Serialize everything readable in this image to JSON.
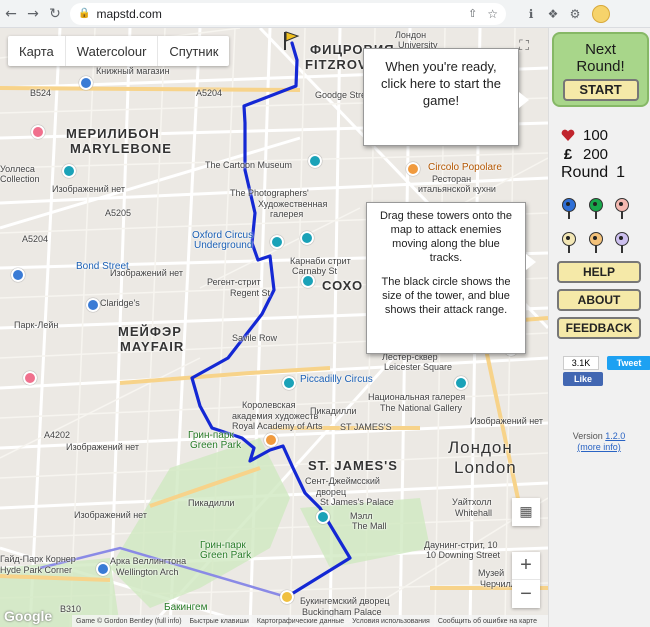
{
  "browser": {
    "back": "←",
    "forward": "→",
    "reload": "↻",
    "url": "mapstd.com",
    "lock": "🔒"
  },
  "map": {
    "map_types": [
      "Карта",
      "Watercolour",
      "Спутник"
    ],
    "google": "Google",
    "footer": [
      "Game © Gordon Bentley (full info)",
      "Быстрые клавиши",
      "Картографические данные",
      "Условия использования",
      "Сообщить об ошибке на карте"
    ],
    "labels": {
      "fitzrovia_ru": "ФИЦРОВИЯ",
      "fitzrovia_en": "FITZROVIA",
      "london_univ": "Лондон",
      "univ": "University",
      "goodge": "Goodge Street",
      "bookshop": "Книжный магазин",
      "marylebone_ru": "МЕРИЛИБОН",
      "marylebone_en": "MARYLEBONE",
      "wallace": "Уоллеса",
      "wallace2": "Collection",
      "cartoon": "The Cartoon Museum",
      "photographers": "The Photographers'",
      "gallery_ru": "Художественная",
      "gallery_ru2": "галерея",
      "circolo": "Circolo Popolare",
      "circolo2": "Ресторан",
      "circolo3": "итальянской кухни",
      "oxford": "Oxford Circus",
      "underground": "Underground",
      "bond": "Bond Street",
      "claridges": "Claridge's",
      "carnaby_ru": "Карнаби стрит",
      "carnaby_en": "Carnaby St",
      "regent_ru": "Регент-стрит",
      "regent_en": "Regent St",
      "soho": "СОХО",
      "mayfair_ru": "МЕЙФЭР",
      "mayfair_en": "MAYFAIR",
      "savile": "Savile Row",
      "leicester_ru": "Лестер-сквер",
      "leicester_en": "Leicester Square",
      "piccadilly": "Piccadilly Circus",
      "natgal_ru": "Национальная галерея",
      "natgal_en": "The National Gallery",
      "royal_ru": "Королевская",
      "royal_ru2": "академия художеств",
      "royal_en": "Royal Academy of Arts",
      "piccadilly_ru": "Пикадилли",
      "stjames_top": "ST JAMES'S",
      "stjames": "ST. JAMES'S",
      "london_ru": "Лондон",
      "london_en": "London",
      "greenpark_ru": "Грин-парк",
      "greenpark_en": "Green Park",
      "stjamespal_ru": "Сент-Джеймсский",
      "stjamespal_ru2": "дворец",
      "stjamespal_en": "St James's Palace",
      "mall_ru": "Мэлл",
      "mall_en": "The Mall",
      "whitehall_ru": "Уайтхолл",
      "whitehall_en": "Whitehall",
      "greenpark2": "Грин-парк",
      "greenpark3": "Green Park",
      "downing_ru": "Даунинг-стрит, 10",
      "downing_en": "10 Downing Street",
      "museum": "Музей",
      "museum2": "Черчилля",
      "hydepark_ru": "Гайд-Парк Корнер",
      "hydepark_en": "Hyde Park Corner",
      "wellington_ru": "Арка Веллингтона",
      "wellington_en": "Wellington Arch",
      "buckingham_ru": "Букингемский дворец",
      "buckingham_en": "Buckingham Palace",
      "bakingem": "Бакингем",
      "izob": "Изображений нет",
      "b524": "B524",
      "a5204": "A5204",
      "a5205": "A5205",
      "a4202": "A4202",
      "b310": "B310",
      "park_lane": "Парк-Лейн",
      "pikadilly2": "Пикадилли"
    }
  },
  "tooltips": {
    "start": "When you're ready, click here to start the game!",
    "towers_p1": "Drag these towers onto the map to attack enemies moving along the blue tracks.",
    "towers_p2": "The black circle shows the size of the tower, and blue shows their attack range."
  },
  "panel": {
    "next_round": "Next Round!",
    "start": "START",
    "lives_icon": "heart-icon",
    "lives": "100",
    "money_icon": "£",
    "money": "200",
    "round_label": "Round",
    "round": "1",
    "towers": [
      {
        "name": "blue",
        "color": "#2f6fd6"
      },
      {
        "name": "green",
        "color": "#18a84b"
      },
      {
        "name": "pink",
        "color": "#f4b8b0"
      },
      {
        "name": "cream",
        "color": "#f3e7b5"
      },
      {
        "name": "orange",
        "color": "#f4c27a"
      },
      {
        "name": "lavender",
        "color": "#cdc0ef"
      }
    ],
    "help": "HELP",
    "about": "ABOUT",
    "feedback": "FEEDBACK",
    "fb_count": "3.1K",
    "fb_like": "Like",
    "tweet": "Tweet",
    "version_label": "Version",
    "version": "1.2.0",
    "more_info": "(more info)"
  },
  "colors": {
    "track": "#1428d4",
    "next_round_bg": "#a8d68a",
    "button_bg": "#f5e9a8"
  }
}
